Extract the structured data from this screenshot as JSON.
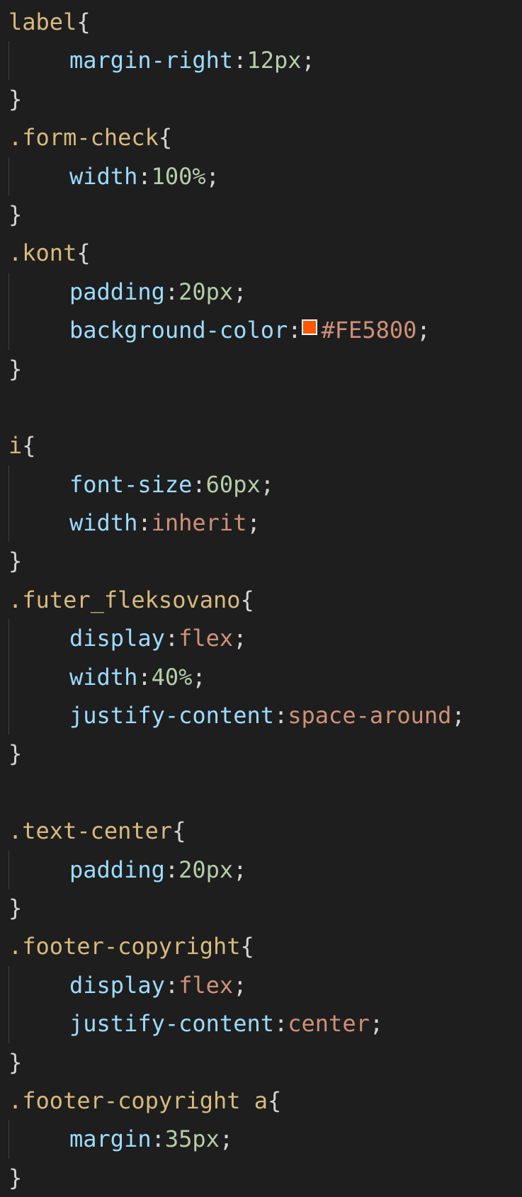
{
  "colors": {
    "background": "#1e1e1e",
    "selector": "#d7ba7d",
    "property": "#9cdcfe",
    "number": "#b5cea8",
    "string_value": "#ce9178",
    "punctuation": "#d4d4d4",
    "swatch": "#FE5800"
  },
  "code": {
    "b1_sel": "label",
    "b1_p1": "margin-right",
    "b1_v1": "12px",
    "b2_sel": ".form-check",
    "b2_p1": "width",
    "b2_v1": "100%",
    "b3_sel": ".kont",
    "b3_p1": "padding",
    "b3_v1": "20px",
    "b3_p2": "background-color",
    "b3_v2": "#FE5800",
    "b4_sel": "i",
    "b4_p1": "font-size",
    "b4_v1": "60px",
    "b4_p2": "width",
    "b4_v2": "inherit",
    "b5_sel": ".futer_fleksovano",
    "b5_p1": "display",
    "b5_v1": "flex",
    "b5_p2": "width",
    "b5_v2": "40%",
    "b5_p3": "justify-content",
    "b5_v3": "space-around",
    "b6_sel": ".text-center",
    "b6_p1": "padding",
    "b6_v1": "20px",
    "b7_sel": ".footer-copyright",
    "b7_p1": "display",
    "b7_v1": "flex",
    "b7_p2": "justify-content",
    "b7_v2": "center",
    "b8_sel": ".footer-copyright a",
    "b8_p1": "margin",
    "b8_v1": "35px",
    "open_brace": "{",
    "close_brace": "}",
    "colon": ":",
    "semicolon": ";"
  }
}
